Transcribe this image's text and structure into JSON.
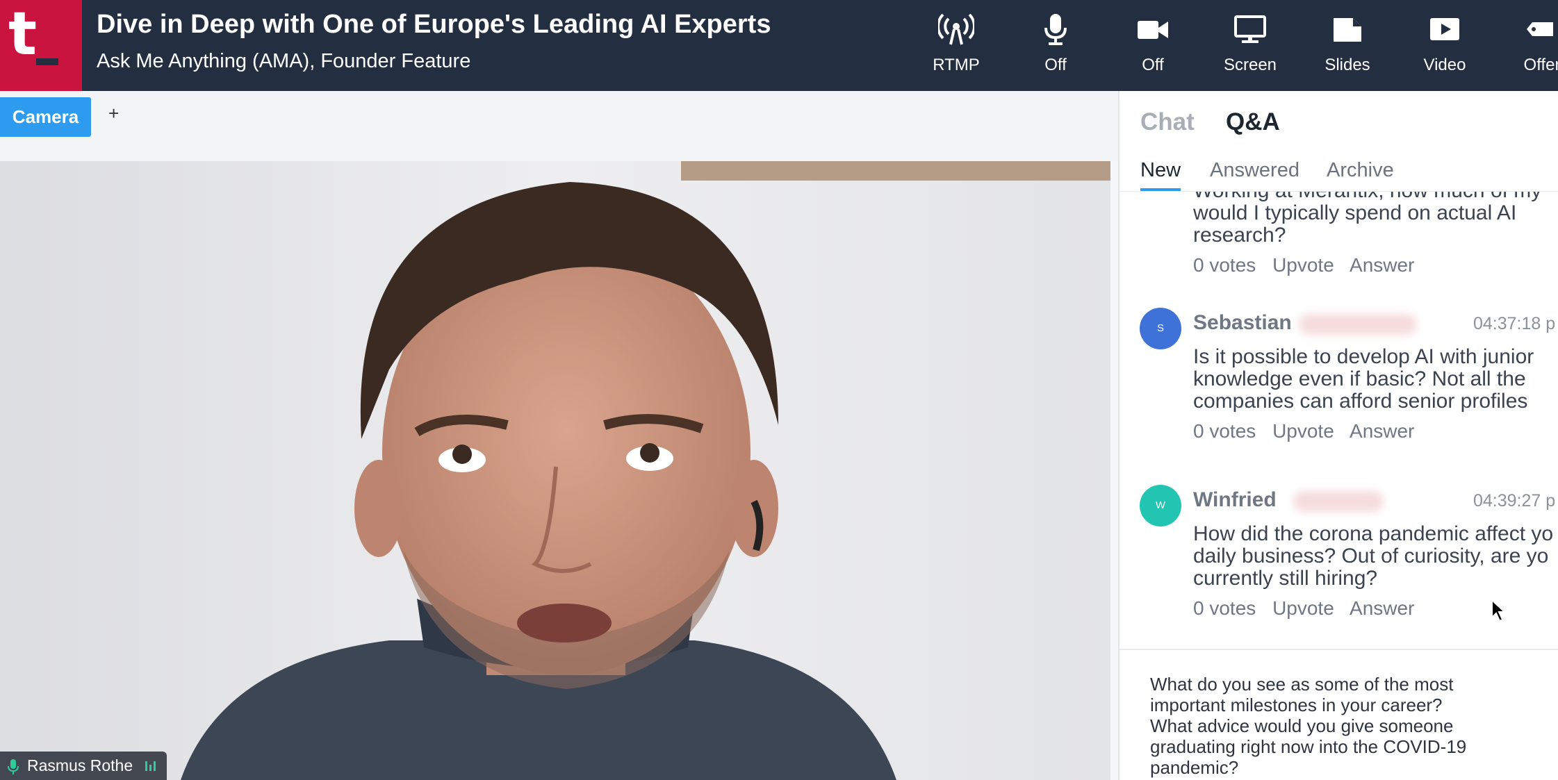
{
  "header": {
    "logo_letter": "t",
    "title": "Dive in Deep with One of Europe's Leading AI Experts",
    "subtitle": "Ask Me Anything (AMA), Founder Feature"
  },
  "toolbar": [
    {
      "label": "RTMP",
      "icon": "broadcast-icon"
    },
    {
      "label": "Off",
      "icon": "microphone-icon"
    },
    {
      "label": "Off",
      "icon": "camera-icon"
    },
    {
      "label": "Screen",
      "icon": "monitor-icon"
    },
    {
      "label": "Slides",
      "icon": "slides-icon"
    },
    {
      "label": "Video",
      "icon": "play-video-icon"
    },
    {
      "label": "Offer",
      "icon": "tag-icon"
    }
  ],
  "stage": {
    "camera_tab": "Camera",
    "add_tab": "+",
    "speaker_name": "Rasmus Rothe"
  },
  "panel": {
    "tabs": {
      "chat": "Chat",
      "qa": "Q&A"
    },
    "subtabs": {
      "new": "New",
      "answered": "Answered",
      "archive": "Archive"
    },
    "questions": [
      {
        "lines": [
          "Working at Merantix, how much of my",
          "would I typically spend on actual AI",
          "research?"
        ],
        "votes": "0 votes",
        "upvote": "Upvote",
        "answer": "Answer"
      },
      {
        "author": "Sebastian",
        "initial": "S",
        "time": "04:37:18 p",
        "lines": [
          "Is it possible to develop AI with junior",
          "knowledge even if basic? Not all the",
          "companies can afford senior profiles"
        ],
        "votes": "0 votes",
        "upvote": "Upvote",
        "answer": "Answer"
      },
      {
        "author": "Winfried",
        "initial": "W",
        "time": "04:39:27 p",
        "lines": [
          "How did the corona pandemic affect yo",
          "daily business? Out of curiosity, are yo",
          "currently still hiring?"
        ],
        "votes": "0 votes",
        "upvote": "Upvote",
        "answer": "Answer"
      }
    ],
    "composer_text": "What do you see as some of the most\nimportant milestones in your career?\nWhat advice would you give someone\ngraduating right now into the COVID-19\npandemic?"
  },
  "colors": {
    "topbar": "#232e41",
    "logo": "#c8143f",
    "accent": "#2d9bf0",
    "avatar_s": "#3f72d8",
    "avatar_w": "#22c5b2"
  }
}
